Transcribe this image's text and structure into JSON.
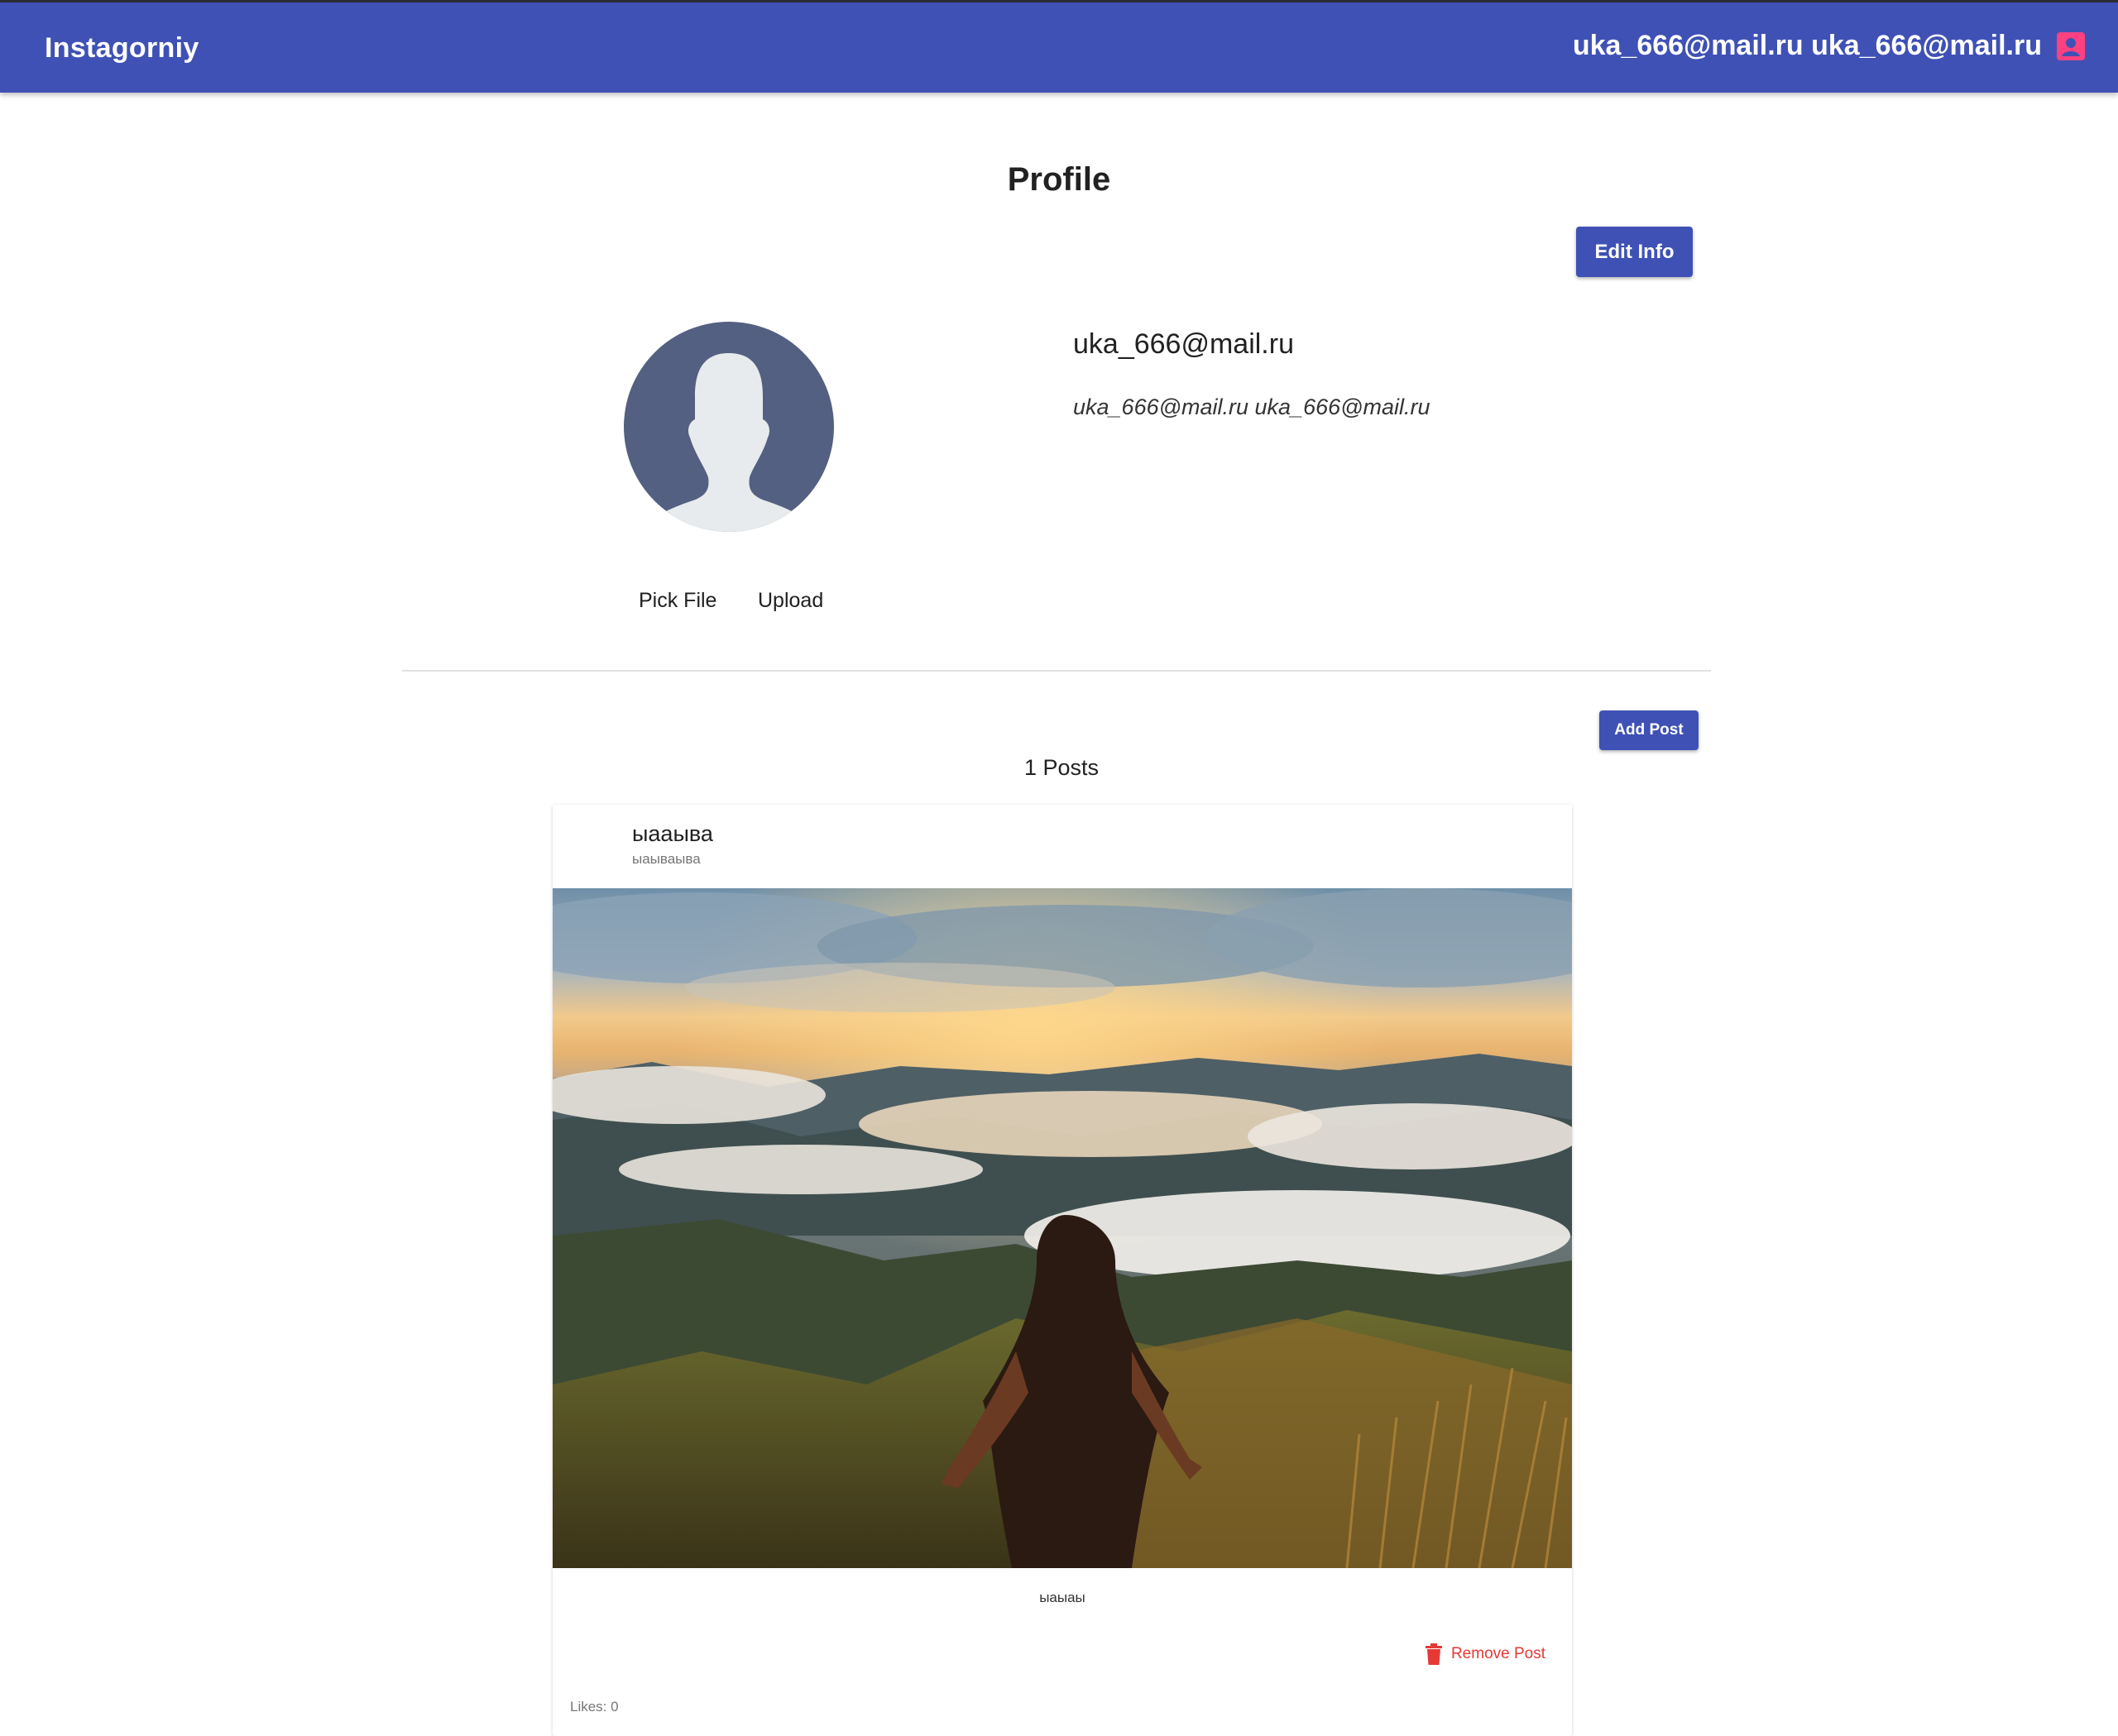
{
  "appbar": {
    "brand": "Instagorniy",
    "user_label": "uka_666@mail.ru uka_666@mail.ru",
    "user_icon": "account-box-icon",
    "color": "#3f51b5",
    "icon_color": "#ff4081"
  },
  "profile": {
    "title": "Profile",
    "edit_label": "Edit Info",
    "name": "uka_666@mail.ru",
    "full_name": "uka_666@mail.ru uka_666@mail.ru",
    "avatar_icon": "default-avatar-icon",
    "pick_file_label": "Pick File",
    "upload_label": "Upload"
  },
  "posts": {
    "add_label": "Add Post",
    "count_label": "1 Posts",
    "items": [
      {
        "title": "ыаaыва",
        "subtitle": "ыаываыва",
        "image_icon": "mountain-landscape-photo",
        "caption": "ыаыаы",
        "remove_label": "Remove Post",
        "remove_icon": "trash-icon",
        "likes_label": "Likes: 0"
      }
    ]
  }
}
